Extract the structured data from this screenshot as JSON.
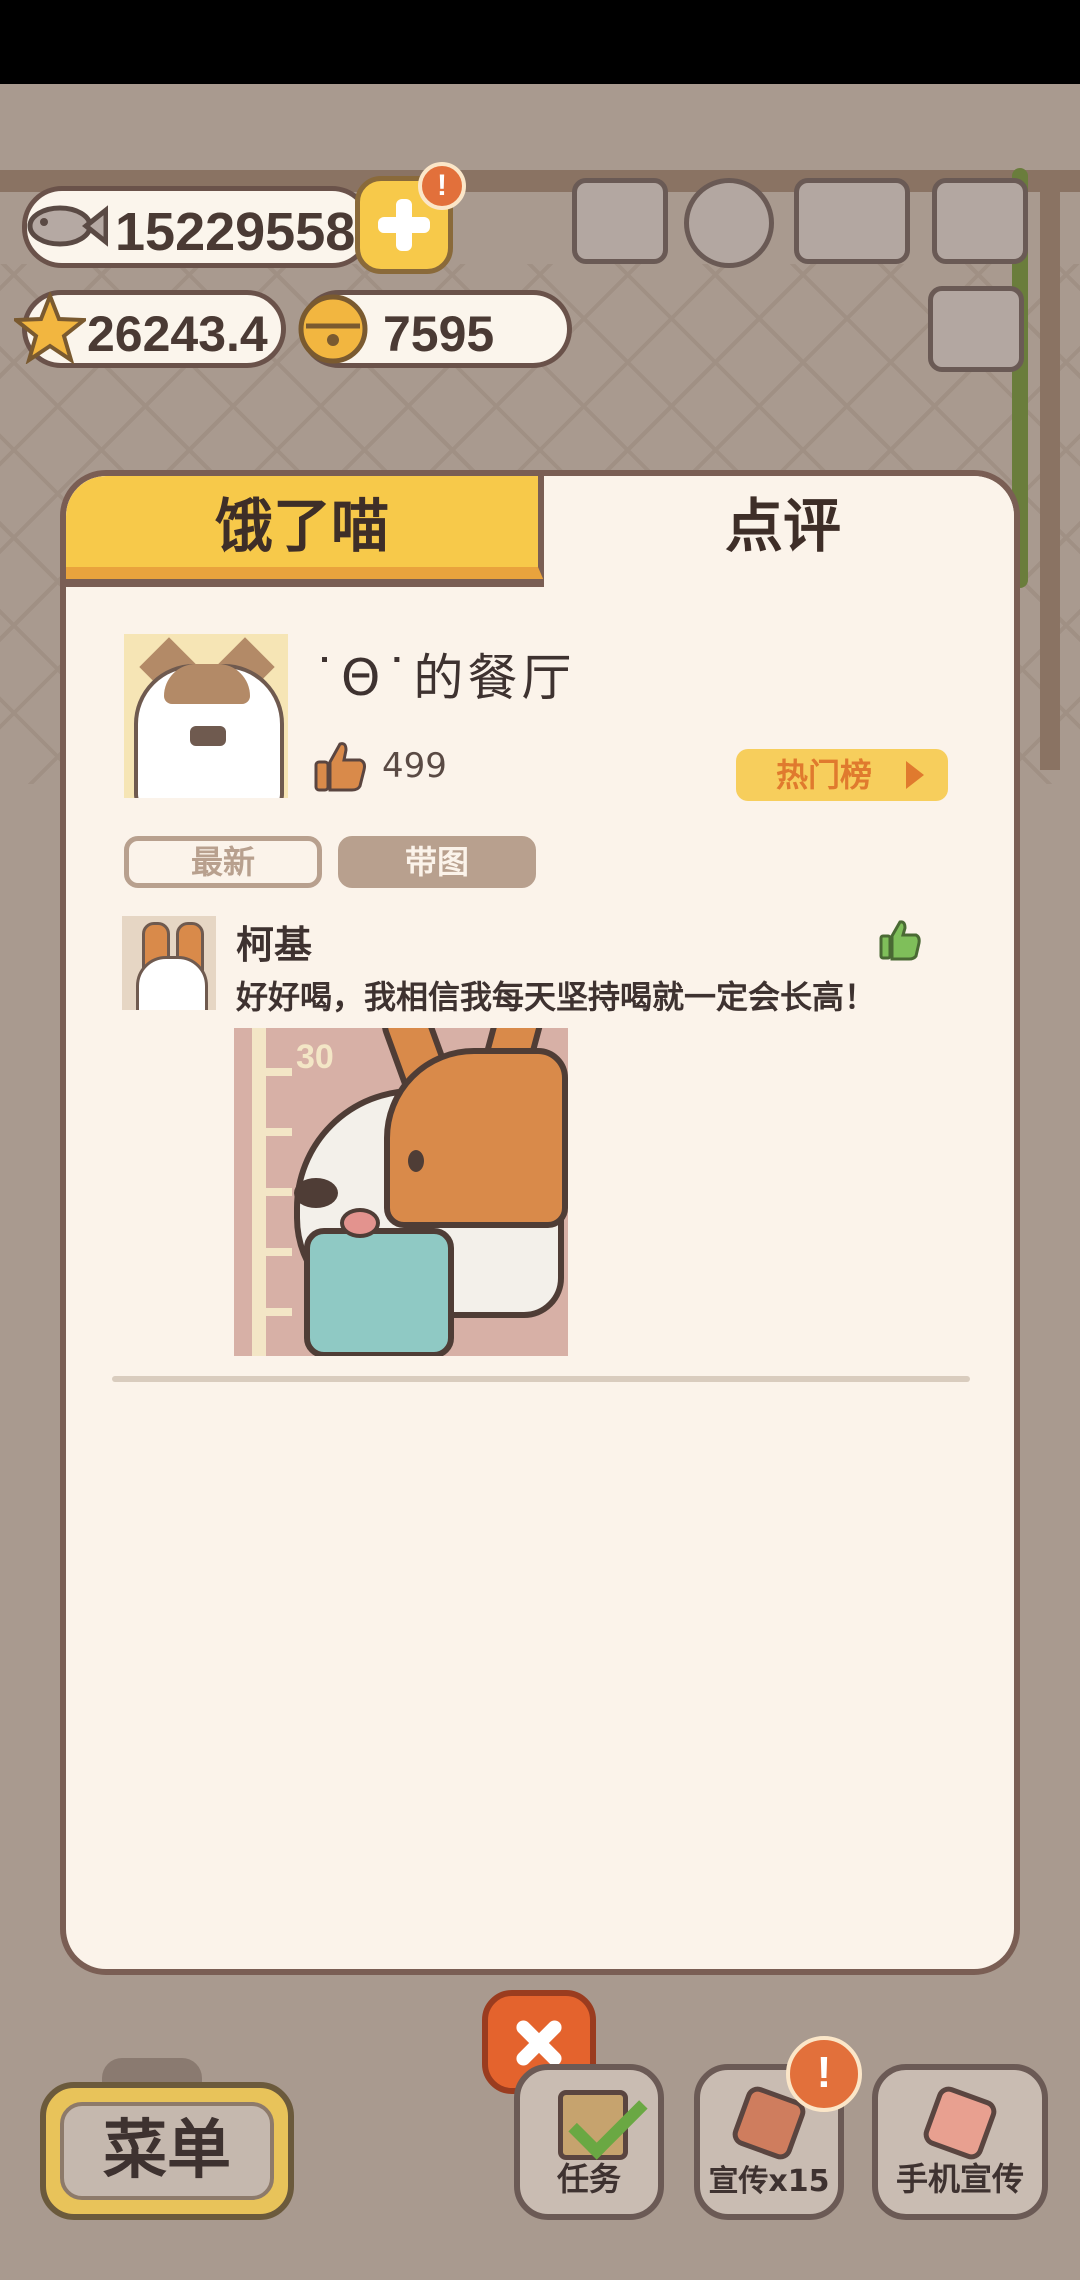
{
  "currency": {
    "fish": "15229558",
    "stars": "26243.4",
    "bells": "7595",
    "plus_alert": "!"
  },
  "tabs": {
    "hungry_cat": "饿了喵",
    "reviews": "点评"
  },
  "restaurant": {
    "name": "˙Θ˙的餐厅",
    "likes": "499",
    "hot_list_label": "热门榜"
  },
  "filters": {
    "latest": "最新",
    "with_pictures": "带图"
  },
  "reviews": [
    {
      "author": "柯基",
      "text": "好好喝，我相信我每天坚持喝就一定会长高！",
      "image_label": "30"
    }
  ],
  "bottom_bar": {
    "menu": "菜单",
    "tasks": "任务",
    "promote": "宣传x15",
    "promote_alert": "!",
    "phone_promote": "手机宣传"
  },
  "colors": {
    "accent_yellow": "#f7c94a",
    "panel_bg": "#fbf3ea",
    "close_orange": "#e4632d",
    "like_green": "#7fbf5a"
  }
}
